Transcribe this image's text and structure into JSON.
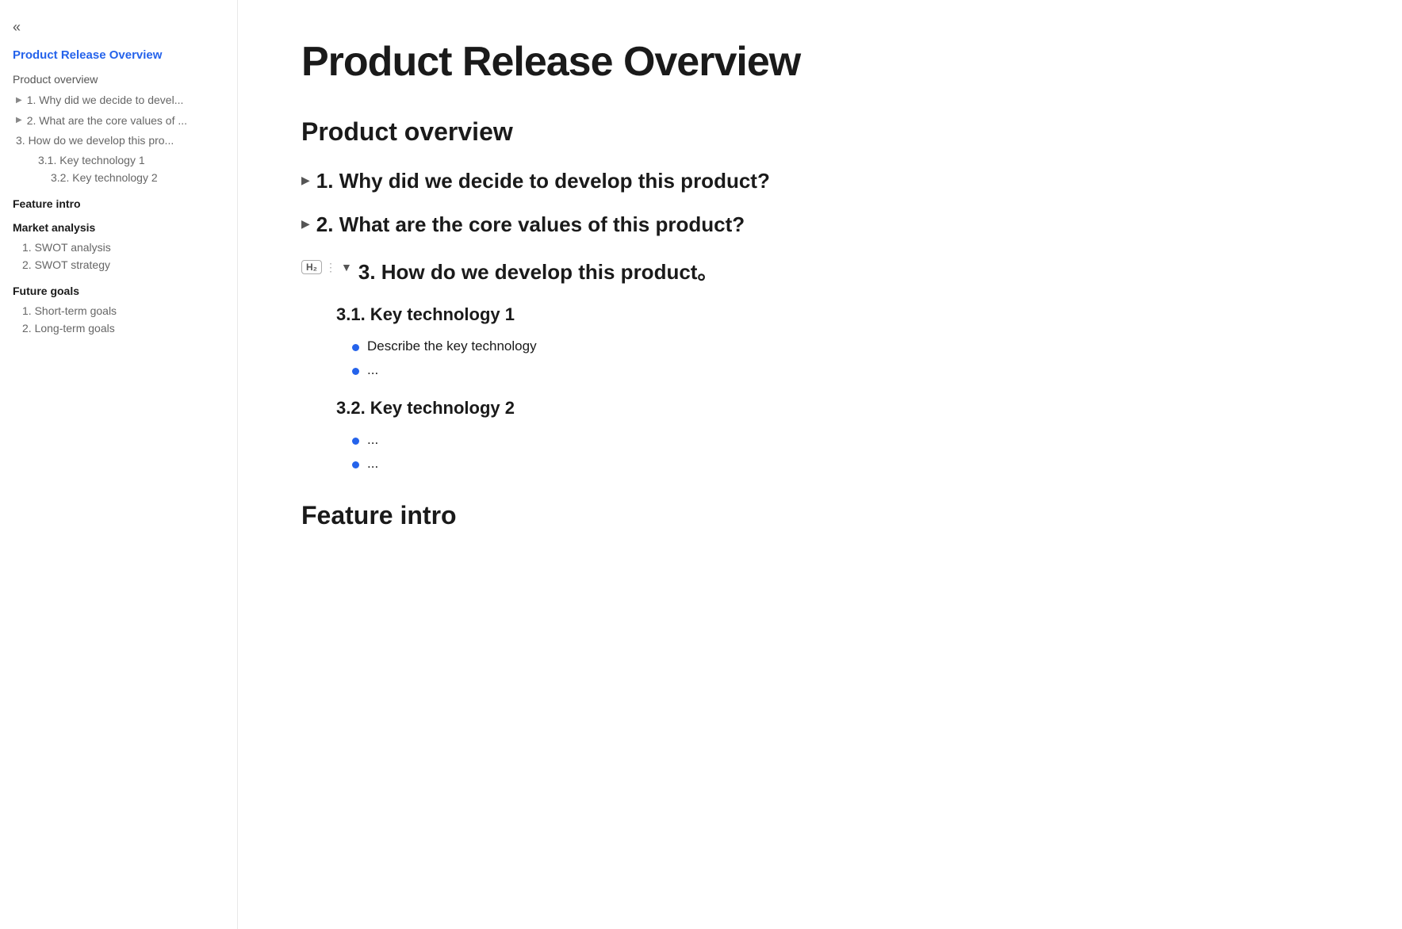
{
  "sidebar": {
    "back_icon": "«",
    "title": "Product Release Overview",
    "sections": [
      {
        "label": "Product overview",
        "items": [
          {
            "text": "1. Why did we decide to devel...",
            "arrow": true,
            "indent": 0
          },
          {
            "text": "2. What are the core values of ...",
            "arrow": true,
            "indent": 0
          },
          {
            "text": "3. How do we develop this pro...",
            "arrow": false,
            "indent": 0
          },
          {
            "text": "3.1. Key technology 1",
            "arrow": false,
            "indent": 1
          },
          {
            "text": "3.2. Key technology 2",
            "arrow": false,
            "indent": 2
          }
        ]
      },
      {
        "label": "Feature intro",
        "items": []
      },
      {
        "label": "Market analysis",
        "items": [
          {
            "text": "1. SWOT analysis",
            "numbered": true
          },
          {
            "text": "2. SWOT strategy",
            "numbered": true
          }
        ]
      },
      {
        "label": "Future goals",
        "items": [
          {
            "text": "1. Short-term goals",
            "numbered": true
          },
          {
            "text": "2. Long-term goals",
            "numbered": true
          }
        ]
      }
    ]
  },
  "main": {
    "page_title": "Product Release Overview",
    "section_heading": "Product overview",
    "items": [
      {
        "type": "collapsible_closed",
        "text": "1. Why did we decide to develop this product?"
      },
      {
        "type": "collapsible_closed",
        "text": "2. What are the  core values of this product?"
      },
      {
        "type": "collapsible_open",
        "text": "3. How do we develop this product。",
        "toolbar": {
          "badge": "H₂",
          "dots": "⋮"
        },
        "children": [
          {
            "subheading": "3.1. Key technology 1",
            "bullets": [
              "Describe the key  technology",
              "..."
            ]
          },
          {
            "subheading": "3.2. Key technology 2",
            "bullets": [
              "...",
              "..."
            ]
          }
        ]
      }
    ],
    "feature_intro_heading": "Feature intro"
  },
  "colors": {
    "accent_blue": "#2563eb",
    "text_dark": "#1a1a1a",
    "text_gray": "#666666",
    "border": "#e8e8e8"
  }
}
